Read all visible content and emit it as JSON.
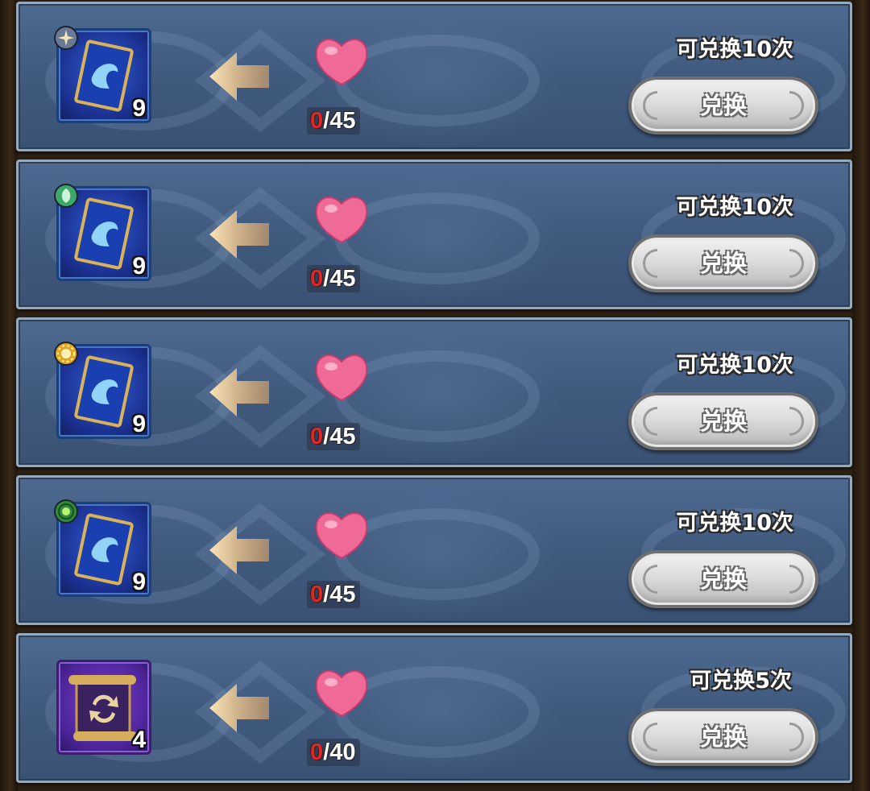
{
  "exchange_list": {
    "rows": [
      {
        "item_icon": "card-pack-icon",
        "badge_icon": "star-badge-icon",
        "badge_color": "#6b7896",
        "item_count": "9",
        "cost_have": "0",
        "cost_need": "/45",
        "limit_text": "可兑换10次",
        "button_label": "兑换"
      },
      {
        "item_icon": "card-pack-icon",
        "badge_icon": "leaf-badge-icon",
        "badge_color": "#3ea86a",
        "item_count": "9",
        "cost_have": "0",
        "cost_need": "/45",
        "limit_text": "可兑换10次",
        "button_label": "兑换"
      },
      {
        "item_icon": "card-pack-icon",
        "badge_icon": "sun-badge-icon",
        "badge_color": "#e2a51f",
        "item_count": "9",
        "cost_have": "0",
        "cost_need": "/45",
        "limit_text": "可兑换10次",
        "button_label": "兑换"
      },
      {
        "item_icon": "card-pack-icon",
        "badge_icon": "nature-badge-icon",
        "badge_color": "#2f8a3a",
        "item_count": "9",
        "cost_have": "0",
        "cost_need": "/45",
        "limit_text": "可兑换10次",
        "button_label": "兑换"
      },
      {
        "item_icon": "scroll-icon",
        "badge_icon": "",
        "badge_color": "",
        "item_count": "4",
        "cost_have": "0",
        "cost_need": "/40",
        "limit_text": "可兑换5次",
        "button_label": "兑换"
      }
    ]
  },
  "colors": {
    "row_background": "#435d82",
    "cost_have": "#e52424",
    "heart": "#f06a98",
    "arrow": "#f1c48a"
  }
}
